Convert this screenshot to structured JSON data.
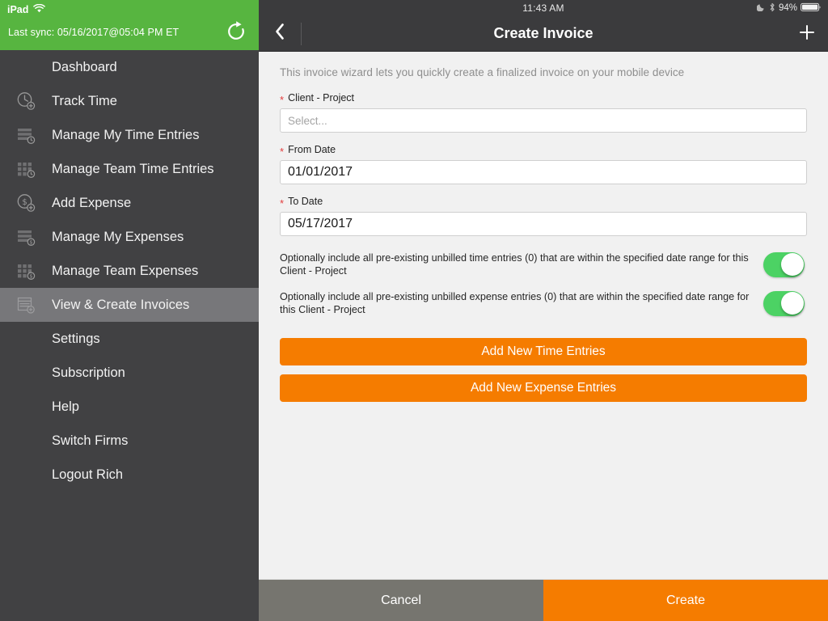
{
  "sidebar": {
    "device_label": "iPad",
    "wifi_icon": "wifi-icon",
    "sync_label": "Last sync:",
    "sync_value": "05/16/2017@05:04 PM ET",
    "sync_text": "Last sync:  05/16/2017@05:04 PM ET",
    "refresh_icon": "refresh-icon",
    "header_color": "#57b540",
    "background_color": "#414143",
    "selected_color": "#77777a",
    "items": [
      {
        "label": "Dashboard",
        "icon": "none",
        "selected": false
      },
      {
        "label": "Track Time",
        "icon": "clock-plus-icon",
        "selected": false
      },
      {
        "label": "Manage My Time Entries",
        "icon": "list-clock-icon",
        "selected": false
      },
      {
        "label": "Manage Team Time Entries",
        "icon": "grid-clock-icon",
        "selected": false
      },
      {
        "label": "Add Expense",
        "icon": "dollar-plus-icon",
        "selected": false
      },
      {
        "label": "Manage My Expenses",
        "icon": "list-dollar-icon",
        "selected": false
      },
      {
        "label": "Manage Team Expenses",
        "icon": "grid-dollar-icon",
        "selected": false
      },
      {
        "label": "View & Create Invoices",
        "icon": "invoice-plus-icon",
        "selected": true
      },
      {
        "label": "Settings",
        "icon": "none",
        "selected": false
      },
      {
        "label": "Subscription",
        "icon": "none",
        "selected": false
      },
      {
        "label": "Help",
        "icon": "none",
        "selected": false
      },
      {
        "label": "Switch Firms",
        "icon": "none",
        "selected": false
      },
      {
        "label": "Logout Rich",
        "icon": "none",
        "selected": false
      }
    ]
  },
  "status_bar": {
    "time": "11:43 AM",
    "dnd_icon": "moon-icon",
    "bluetooth_icon": "bluetooth-icon",
    "battery_percent": "94%",
    "battery_icon": "battery-icon"
  },
  "navbar": {
    "back_icon": "chevron-left-icon",
    "title": "Create Invoice",
    "add_icon": "plus-icon"
  },
  "form": {
    "intro": "This invoice wizard lets you quickly create a finalized invoice on your mobile device",
    "required_marker": "*",
    "client_project": {
      "label": "Client - Project",
      "value": "",
      "placeholder": "Select..."
    },
    "from_date": {
      "label": "From Date",
      "value": "01/01/2017"
    },
    "to_date": {
      "label": "To Date",
      "value": "05/17/2017"
    },
    "toggle_time": {
      "text": "Optionally include all pre-existing unbilled time entries (0) that are within the specified date range for this Client - Project",
      "state": "on"
    },
    "toggle_expense": {
      "text": "Optionally include all pre-existing unbilled expense entries (0) that are within the specified date range for this Client - Project",
      "state": "on"
    },
    "add_time_button": "Add New Time Entries",
    "add_expense_button": "Add New Expense Entries",
    "accent_color": "#f57c00"
  },
  "footer": {
    "cancel_label": "Cancel",
    "create_label": "Create",
    "cancel_color": "#76756f",
    "create_color": "#f57c00"
  }
}
